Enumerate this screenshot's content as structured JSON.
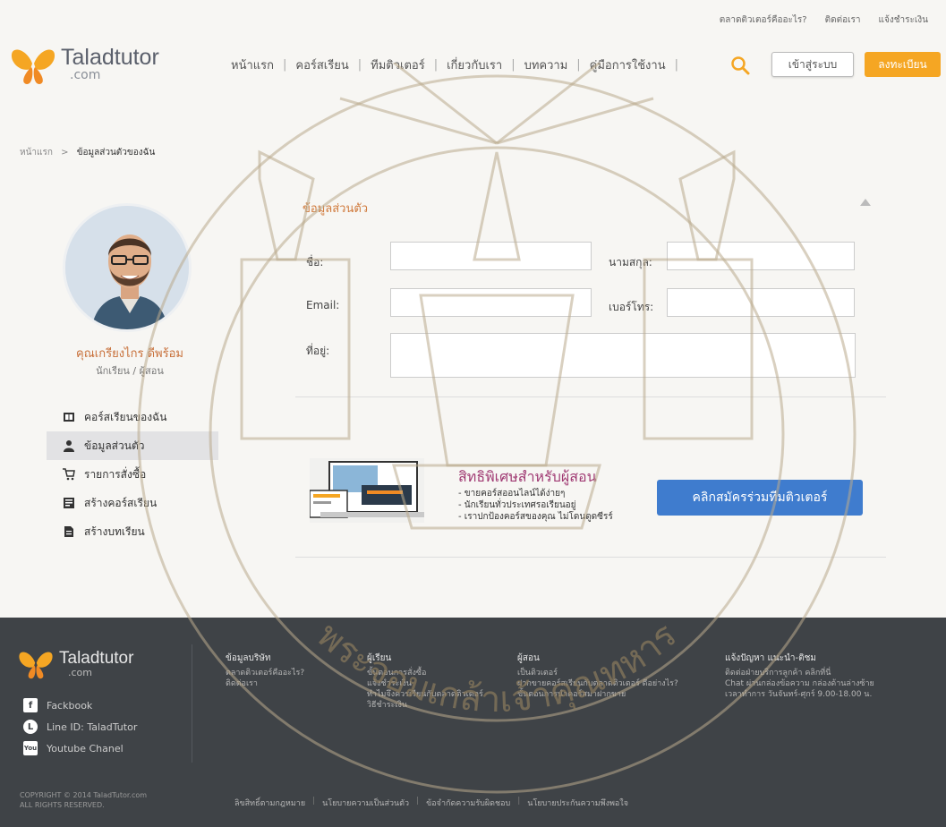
{
  "topbar": {
    "links": [
      "ตลาดติวเตอร์คืออะไร?",
      "ติดต่อเรา",
      "แจ้งชำระเงิน"
    ]
  },
  "header": {
    "logo_text": "Taladtutor",
    "logo_sub": ".com",
    "nav": [
      "หน้าแรก",
      "คอร์สเรียน",
      "ทีมติวเตอร์",
      "เกี่ยวกับเรา",
      "บทความ",
      "คู่มือการใช้งาน"
    ],
    "login_label": "เข้าสู่ระบบ",
    "register_label": "ลงทะเบียน",
    "accent_color": "#f5a623"
  },
  "breadcrumb": {
    "home": "หน้าแรก",
    "separator": ">",
    "current": "ข้อมูลส่วนตัวของฉัน"
  },
  "profile": {
    "name": "คุณเกรียงไกร ดีพร้อม",
    "role": "นักเรียน / ผู้สอน",
    "menu": [
      {
        "label": "คอร์สเรียนของฉัน",
        "icon": "book-icon",
        "active": false
      },
      {
        "label": "ข้อมูลส่วนตัว",
        "icon": "user-icon",
        "active": true
      },
      {
        "label": "รายการสั่งซื้อ",
        "icon": "cart-icon",
        "active": false
      },
      {
        "label": "สร้างคอร์สเรียน",
        "icon": "create-course-icon",
        "active": false
      },
      {
        "label": "สร้างบทเรียน",
        "icon": "lesson-icon",
        "active": false
      }
    ]
  },
  "form": {
    "title": "ข้อมูลส่วนตัว",
    "first_name_label": "ชื่อ:",
    "last_name_label": "นามสกุล:",
    "email_label": "Email:",
    "phone_label": "เบอร์โทร:",
    "address_label": "ที่อยู่:"
  },
  "promo": {
    "title": "สิทธิพิเศษสำหรับผู้สอน",
    "points": [
      "- ขายคอร์สออนไลน์ได้ง่ายๆ",
      "- นักเรียนทั่วประเทศรอเรียนอยู่",
      "- เราปกป้องคอร์สของคุณ ไม่โดนดูดซีรร์"
    ],
    "cta_label": "คลิกสมัครร่วมทีมติวเตอร์",
    "cta_color": "#3f7cce"
  },
  "footer": {
    "logo_text": "Taladtutor",
    "logo_sub": ".com",
    "social": [
      {
        "icon": "facebook-icon",
        "glyph": "f",
        "label": "Fackbook"
      },
      {
        "icon": "line-icon",
        "glyph": "L",
        "label": "Line ID: TaladTutor"
      },
      {
        "icon": "youtube-icon",
        "glyph": "You",
        "label": "Youtube Chanel"
      }
    ],
    "col1": {
      "title": "ข้อมูลบริษัท",
      "items": [
        "ตลาดติวเตอร์คืออะไร?",
        "ติดต่อเรา"
      ]
    },
    "col2": {
      "title": "ผู้เรียน",
      "items": [
        "ขั้นตอนการสั่งซื้อ",
        "แจ้งชำระเงิน",
        "ทำไมจึงควรเรียนกับตลาดติวเตอร์",
        "วิธีชำระเงิน"
      ]
    },
    "col3": {
      "title": "ผู้สอน",
      "items": [
        "เป็นติวเตอร์",
        "ฝากขายคอร์สเรียนกับตลาดติวเตอร์ ดีอย่างไร?",
        "ขั้นตอนการนำคอร์สมาฝากขาย"
      ]
    },
    "col4": {
      "title": "แจ้งปัญหา แนะนำ-ติชม",
      "items": [
        "ติดต่อฝ่ายบริการลูกค้า คลิกที่นี่",
        "Chat ผ่านกล่องข้อความ กล่องด้านล่างซ้าย",
        "เวลาทำการ วันจันทร์-ศุกร์ 9.00-18.00 น."
      ]
    },
    "copyright_1": "COPYRIGHT © 2014 TaladTutor.com",
    "copyright_2": "ALL RIGHTS RESERVED.",
    "bottom_links": [
      "ลิขสิทธิ์ตามกฎหมาย",
      "นโยบายความเป็นส่วนตัว",
      "ข้อจำกัดความรับผิดชอบ",
      "นโยบายประกันความพึงพอใจ"
    ]
  },
  "watermark": {
    "text": "พระจอมเกล้าเจ้าคุณทหาร",
    "color": "#b9a98c"
  }
}
